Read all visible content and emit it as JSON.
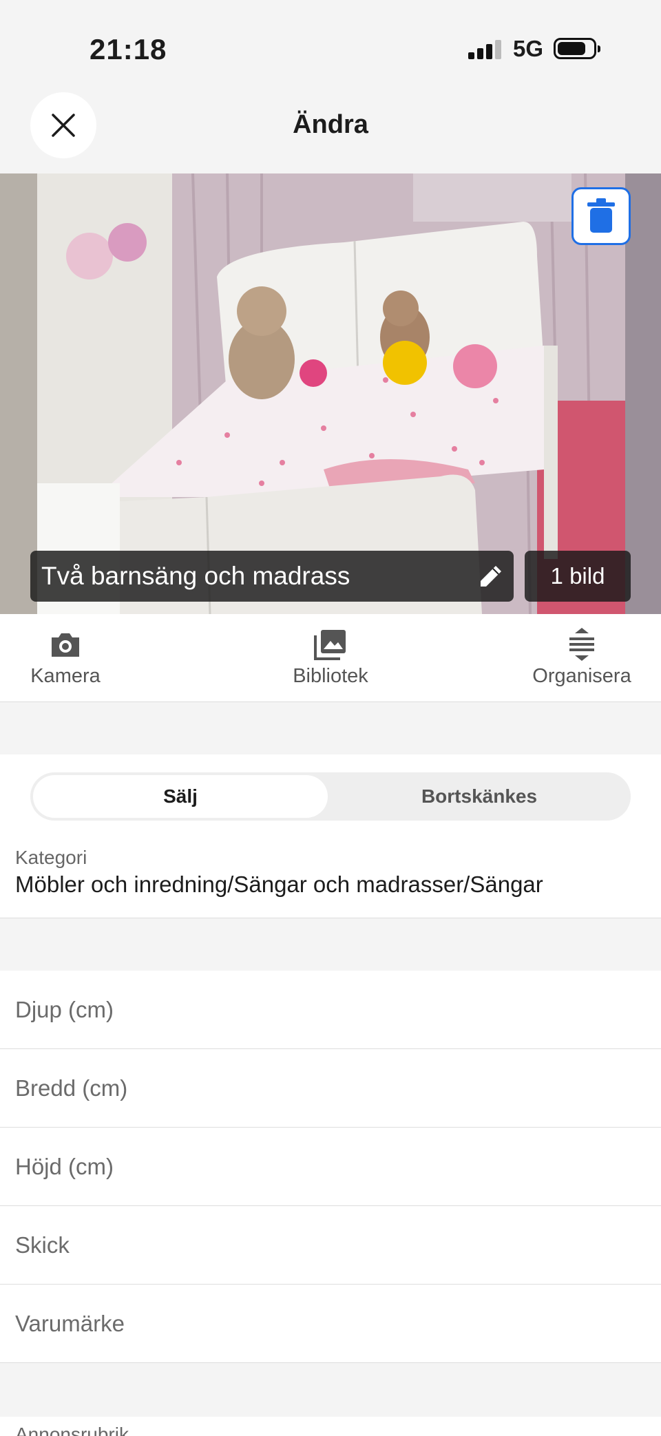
{
  "status_bar": {
    "time": "21:18",
    "network": "5G",
    "battery_level": 0.8
  },
  "header": {
    "title": "Ändra",
    "close_icon": "close-icon"
  },
  "photo": {
    "title": "Två barnsäng och madrass",
    "count": "1 bild",
    "delete_icon": "trash-icon",
    "edit_icon": "pencil-icon",
    "accent": "#1f6fe5"
  },
  "toolbar": {
    "camera": {
      "label": "Kamera",
      "icon": "camera-icon"
    },
    "library": {
      "label": "Bibliotek",
      "icon": "photo-library-icon"
    },
    "organize": {
      "label": "Organisera",
      "icon": "reorder-icon"
    }
  },
  "listing_type": {
    "options": [
      "Sälj",
      "Bortskänkes"
    ],
    "selected": "Sälj"
  },
  "category": {
    "label": "Kategori",
    "value": "Möbler och inredning/Sängar och madrasser/Sängar"
  },
  "fields": [
    {
      "placeholder": "Djup (cm)",
      "value": ""
    },
    {
      "placeholder": "Bredd (cm)",
      "value": ""
    },
    {
      "placeholder": "Höjd (cm)",
      "value": ""
    },
    {
      "placeholder": "Skick",
      "value": ""
    },
    {
      "placeholder": "Varumärke",
      "value": ""
    }
  ],
  "next_section": {
    "label": "Annonsrubrik"
  }
}
